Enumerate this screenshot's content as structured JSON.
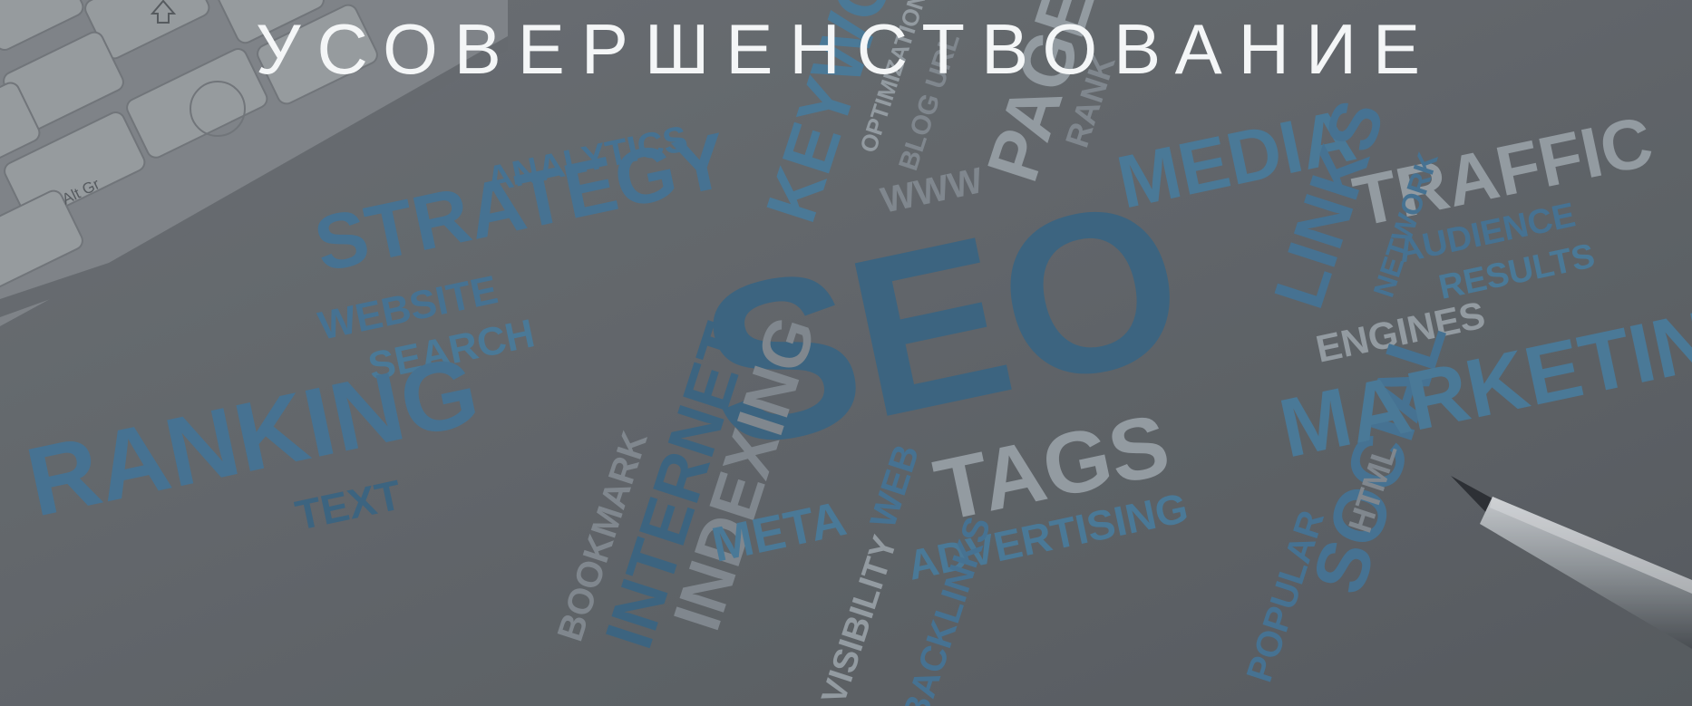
{
  "hero": {
    "title": "УСОВЕРШЕНСТВОВАНИЕ"
  },
  "keyboard": {
    "alt_gr_label": "Alt Gr"
  },
  "word_cloud": {
    "colors": {
      "blue_dark": "#3f6d8b",
      "blue_mid": "#4f84a6",
      "grey": "#8c959b",
      "grey_light": "#a2abb1"
    },
    "words": [
      "SEO",
      "ANALYTICS",
      "STRATEGY",
      "KEYWORDS",
      "OPTIMIZATION",
      "BLOG URL",
      "WWW",
      "PAGE",
      "RANK",
      "MEDIA",
      "TRAFFIC",
      "AUDIENCE",
      "RESULTS",
      "NETWORK",
      "LINKS",
      "ENGINES",
      "WEBSITE",
      "SEARCH",
      "RANKING",
      "TEXT",
      "INTERNET",
      "INDEXING",
      "BOOKMARK",
      "META",
      "WEB",
      "TAGS",
      "ADVERTISING",
      "VISIBILITY",
      "BACKLINKS",
      "SOCIAL",
      "POPULAR",
      "HTML",
      "MARKETING"
    ]
  }
}
